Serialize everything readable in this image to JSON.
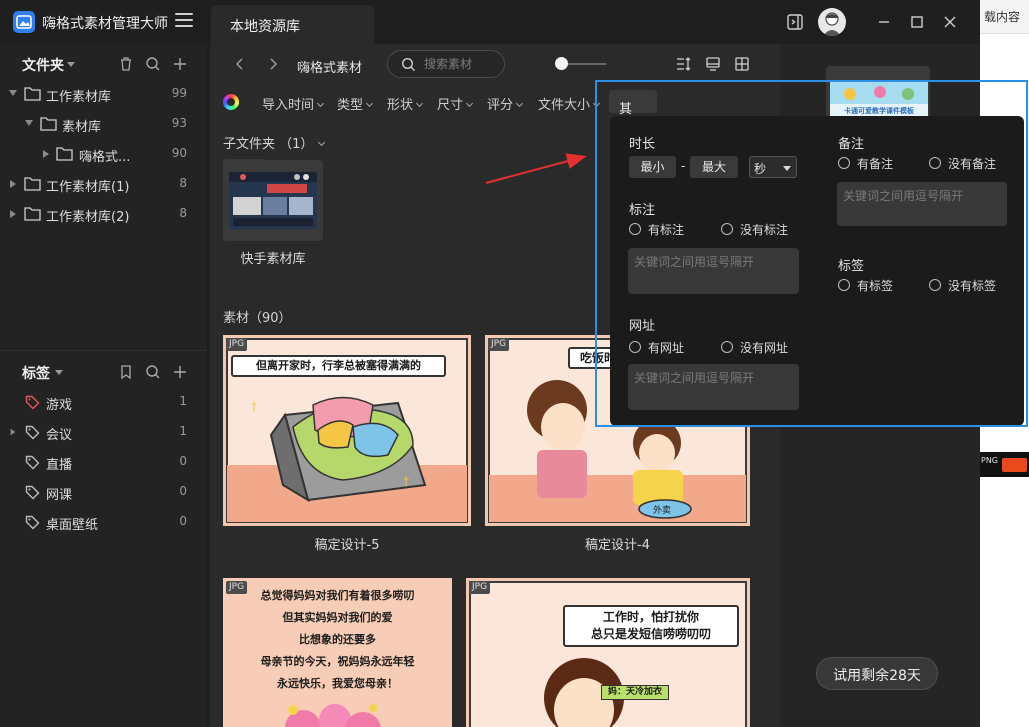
{
  "app": {
    "title": "嗨格式素材管理大师",
    "tab_label": "本地资源库"
  },
  "sidebar": {
    "folders_header": "文件夹",
    "folders": [
      {
        "label": "工作素材库",
        "count": "99"
      },
      {
        "label": "素材库",
        "count": "93"
      },
      {
        "label": "嗨格式...",
        "count": "90"
      },
      {
        "label": "工作素材库(1)",
        "count": "8"
      },
      {
        "label": "工作素材库(2)",
        "count": "8"
      }
    ],
    "tags_header": "标签",
    "tags": [
      {
        "label": "游戏",
        "count": "1",
        "color": "#e05a5a"
      },
      {
        "label": "会议",
        "count": "1",
        "color": "#bdbdbd"
      },
      {
        "label": "直播",
        "count": "0",
        "color": "#bdbdbd"
      },
      {
        "label": "网课",
        "count": "0",
        "color": "#bdbdbd"
      },
      {
        "label": "桌面壁纸",
        "count": "0",
        "color": "#bdbdbd"
      }
    ]
  },
  "toolbar": {
    "breadcrumb": "嗨格式素材",
    "search_placeholder": "搜索素材"
  },
  "filters": {
    "items": [
      "导入时间",
      "类型",
      "形状",
      "尺寸",
      "评分",
      "文件大小"
    ],
    "other": "其他"
  },
  "content": {
    "subfolder_header": "子文件夹 （1）",
    "subfolder_name": "快手素材库",
    "assets_header": "素材（90）",
    "badge": "JPG",
    "assets": [
      {
        "caption": "稿定设计-5",
        "bubble": "但离开家时，行李总被塞得满满的"
      },
      {
        "caption": "稿定设计-4",
        "bubble": "吃饭时"
      },
      {
        "caption": "",
        "lines": [
          "总觉得妈妈对我们有着很多唠叨",
          "但其实妈妈对我们的爱",
          "比想象的还要多",
          "母亲节的今天，祝妈妈永远年轻",
          "永远快乐，我爱您母亲！"
        ]
      },
      {
        "caption": "",
        "bubble_lines": [
          "工作时，怕打扰你",
          "总只是发短信唠唠叨叨"
        ],
        "sign": "妈：天冷加衣"
      }
    ]
  },
  "popup": {
    "duration_label": "时长",
    "min_label": "最小",
    "dash": "-",
    "max_label": "最大",
    "unit": "秒",
    "note_label": "备注",
    "note_yes": "有备注",
    "note_no": "没有备注",
    "note_placeholder": "关键词之间用逗号隔开",
    "mark_label": "标注",
    "mark_yes": "有标注",
    "mark_no": "没有标注",
    "mark_placeholder": "关键词之间用逗号隔开",
    "tag_label": "标签",
    "tag_yes": "有标签",
    "tag_no": "没有标签",
    "url_label": "网址",
    "url_yes": "有网址",
    "url_no": "没有网址",
    "url_placeholder": "关键词之间用逗号隔开"
  },
  "right_panel": {
    "preview_caption": "卡通可爱教学课件模板",
    "trial": "试用剩余28天"
  },
  "external": {
    "snippet_top": "载内容",
    "snippet_png": "PNG"
  }
}
